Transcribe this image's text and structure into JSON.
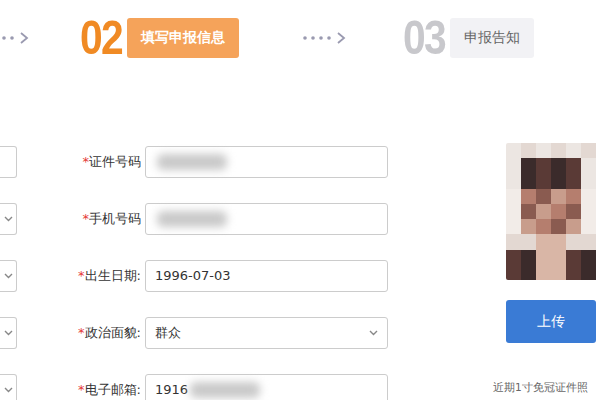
{
  "steps": [
    {
      "number": "02",
      "label": "填写申报信息",
      "selected": true
    },
    {
      "number": "03",
      "label": "申报告知",
      "selected": false
    }
  ],
  "left_fields": [
    {
      "kind": "input"
    },
    {
      "kind": "select"
    },
    {
      "kind": "select"
    },
    {
      "kind": "select"
    },
    {
      "kind": "select"
    }
  ],
  "fields": [
    {
      "mark": "*",
      "label": "证件号码",
      "kind": "input",
      "value": "",
      "blurred": true
    },
    {
      "mark": "*",
      "label": "手机号码",
      "kind": "input",
      "value": "",
      "blurred": true
    },
    {
      "mark": "*",
      "label": "出生日期:",
      "kind": "input",
      "value": "1996-07-03",
      "blurred": false
    },
    {
      "mark": "*",
      "label": "政治面貌:",
      "kind": "select",
      "value": "群众",
      "blurred": false
    },
    {
      "mark": "*",
      "label": "电子邮箱:",
      "kind": "input",
      "value": "1916",
      "blurred": true
    }
  ],
  "photo": {
    "upload_button": "上传",
    "hint": "近期1寸免冠证件照"
  }
}
